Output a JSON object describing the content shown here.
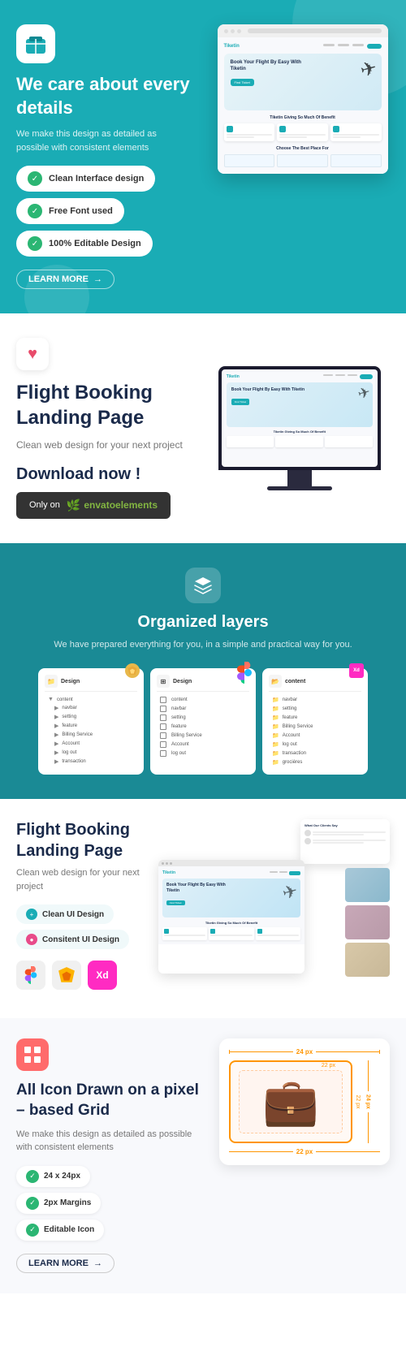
{
  "section1": {
    "icon_label": "package-icon",
    "title": "We care about every details",
    "description": "We make this design as detailed as possible with consistent elements",
    "features": [
      {
        "text": "Clean Interface design",
        "icon": "check-icon"
      },
      {
        "text": "Free Font used",
        "icon": "check-icon"
      },
      {
        "text": "100% Editable Design",
        "icon": "check-icon"
      }
    ],
    "learn_more": "LEARN MORE",
    "mockup": {
      "logo": "Tiketin",
      "hero_title": "Book Your Flight By Easy With Tiketin",
      "button_text": "Find Ticket",
      "section_title": "Tiketin Giving So Much Of Benefit",
      "footer_text": "Choose The Best Place For"
    }
  },
  "section2": {
    "heart_icon": "heart-icon",
    "title": "Flight Booking Landing Page",
    "description": "Clean web design for your next project",
    "download_text": "Download now !",
    "button_prefix": "Only on",
    "envato_name": "envatoelements"
  },
  "section3": {
    "icon_label": "layers-icon",
    "title": "Organized layers",
    "description": "We have prepared everything for you, in a simple and practical way for you.",
    "panels": [
      {
        "name": "Design",
        "badge": "sketch",
        "items": [
          "content",
          "navbar",
          "setting",
          "feature",
          "Billing Service",
          "Account",
          "log out",
          "transaction"
        ]
      },
      {
        "name": "Design",
        "badge": "figma",
        "items": [
          "content",
          "navbar",
          "setting",
          "feature",
          "Billing Service",
          "Account",
          "log out"
        ]
      },
      {
        "name": "content",
        "badge": "xd",
        "items": [
          "navbar",
          "setting",
          "feature",
          "Billing Service",
          "Account",
          "log out",
          "transaction",
          "grocières"
        ]
      }
    ]
  },
  "section4": {
    "title": "Flight Booking Landing Page",
    "description": "Clean web design for your next project",
    "badges": [
      {
        "text": "Clean UI Design",
        "color": "#1AACB5"
      },
      {
        "text": "Consitent UI Design",
        "color": "#e84b8a"
      }
    ],
    "tools": [
      {
        "name": "figma-tool",
        "color": "#1AACB5"
      },
      {
        "name": "sketch-tool",
        "color": "#e8a838"
      },
      {
        "name": "xd-tool",
        "color": "#ff2bc2"
      }
    ]
  },
  "section5": {
    "badge_icon": "grid-icon",
    "title": "All Icon Drawn on a pixel – based Grid",
    "description": "We make this design as detailed as possible with consistent elements",
    "specs": [
      {
        "text": "24 x 24px"
      },
      {
        "text": "2px Margins"
      },
      {
        "text": "Editable Icon"
      }
    ],
    "learn_more": "LEARN MORE",
    "dimensions": {
      "width": "24 px",
      "height": "24 px",
      "inner_width": "22 px",
      "inner_height": "22 px"
    }
  }
}
